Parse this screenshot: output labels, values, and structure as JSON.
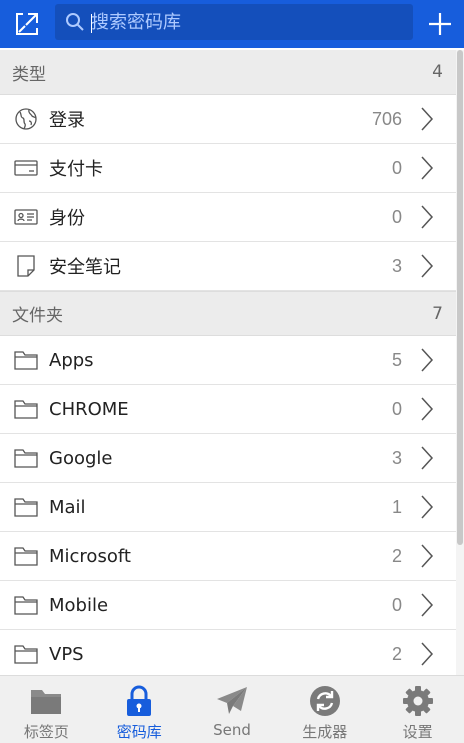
{
  "search": {
    "placeholder": "搜索密码库"
  },
  "types_section": {
    "title": "类型",
    "count": "4",
    "items": [
      {
        "label": "登录",
        "count": "706",
        "icon": "globe-icon"
      },
      {
        "label": "支付卡",
        "count": "0",
        "icon": "credit-card-icon"
      },
      {
        "label": "身份",
        "count": "0",
        "icon": "id-card-icon"
      },
      {
        "label": "安全笔记",
        "count": "3",
        "icon": "note-icon"
      }
    ]
  },
  "folders_section": {
    "title": "文件夹",
    "count": "7",
    "items": [
      {
        "label": "Apps",
        "count": "5"
      },
      {
        "label": "CHROME",
        "count": "0"
      },
      {
        "label": "Google",
        "count": "3"
      },
      {
        "label": "Mail",
        "count": "1"
      },
      {
        "label": "Microsoft",
        "count": "2"
      },
      {
        "label": "Mobile",
        "count": "0"
      },
      {
        "label": "VPS",
        "count": "2"
      }
    ]
  },
  "tabs": [
    {
      "label": "标签页",
      "icon": "folder-tab-icon",
      "active": false
    },
    {
      "label": "密码库",
      "icon": "lock-icon",
      "active": true
    },
    {
      "label": "Send",
      "icon": "paper-plane-icon",
      "active": false
    },
    {
      "label": "生成器",
      "icon": "refresh-icon",
      "active": false
    },
    {
      "label": "设置",
      "icon": "gear-icon",
      "active": false
    }
  ],
  "colors": {
    "brand": "#175ddc",
    "tab_inactive": "#777777",
    "header_bg": "#ececec"
  }
}
